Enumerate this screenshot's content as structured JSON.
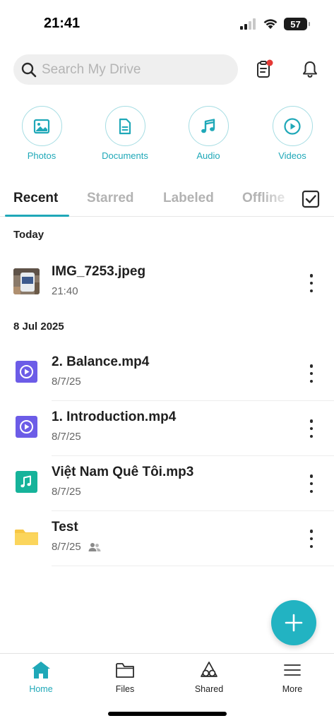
{
  "status_bar": {
    "time": "21:41",
    "battery": "57"
  },
  "search": {
    "placeholder": "Search My Drive"
  },
  "categories": [
    {
      "label": "Photos",
      "icon": "image-icon"
    },
    {
      "label": "Documents",
      "icon": "document-icon"
    },
    {
      "label": "Audio",
      "icon": "music-icon"
    },
    {
      "label": "Videos",
      "icon": "play-icon"
    }
  ],
  "tabs": [
    {
      "label": "Recent",
      "active": true
    },
    {
      "label": "Starred"
    },
    {
      "label": "Labeled"
    },
    {
      "label": "Offline"
    }
  ],
  "sections": [
    {
      "title": "Today",
      "files": [
        {
          "name": "IMG_7253.jpeg",
          "meta": "21:40",
          "type": "image"
        }
      ]
    },
    {
      "title": "8 Jul 2025",
      "files": [
        {
          "name": "2. Balance.mp4",
          "meta": "8/7/25",
          "type": "video"
        },
        {
          "name": "1. Introduction.mp4",
          "meta": "8/7/25",
          "type": "video"
        },
        {
          "name": "Việt Nam Quê Tôi.mp3",
          "meta": "8/7/25",
          "type": "audio"
        },
        {
          "name": "Test",
          "meta": "8/7/25",
          "type": "folder",
          "shared": true
        }
      ]
    }
  ],
  "bottom_nav": [
    {
      "label": "Home",
      "icon": "home-icon",
      "active": true
    },
    {
      "label": "Files",
      "icon": "folder-icon"
    },
    {
      "label": "Shared",
      "icon": "shared-icon"
    },
    {
      "label": "More",
      "icon": "menu-icon"
    }
  ],
  "colors": {
    "accent": "#1fa8b8",
    "fab": "#22b3c2",
    "video_icon": "#6c5ce7",
    "audio_icon": "#16b39a",
    "folder_icon": "#f7c745",
    "notification_dot": "#e53935"
  }
}
